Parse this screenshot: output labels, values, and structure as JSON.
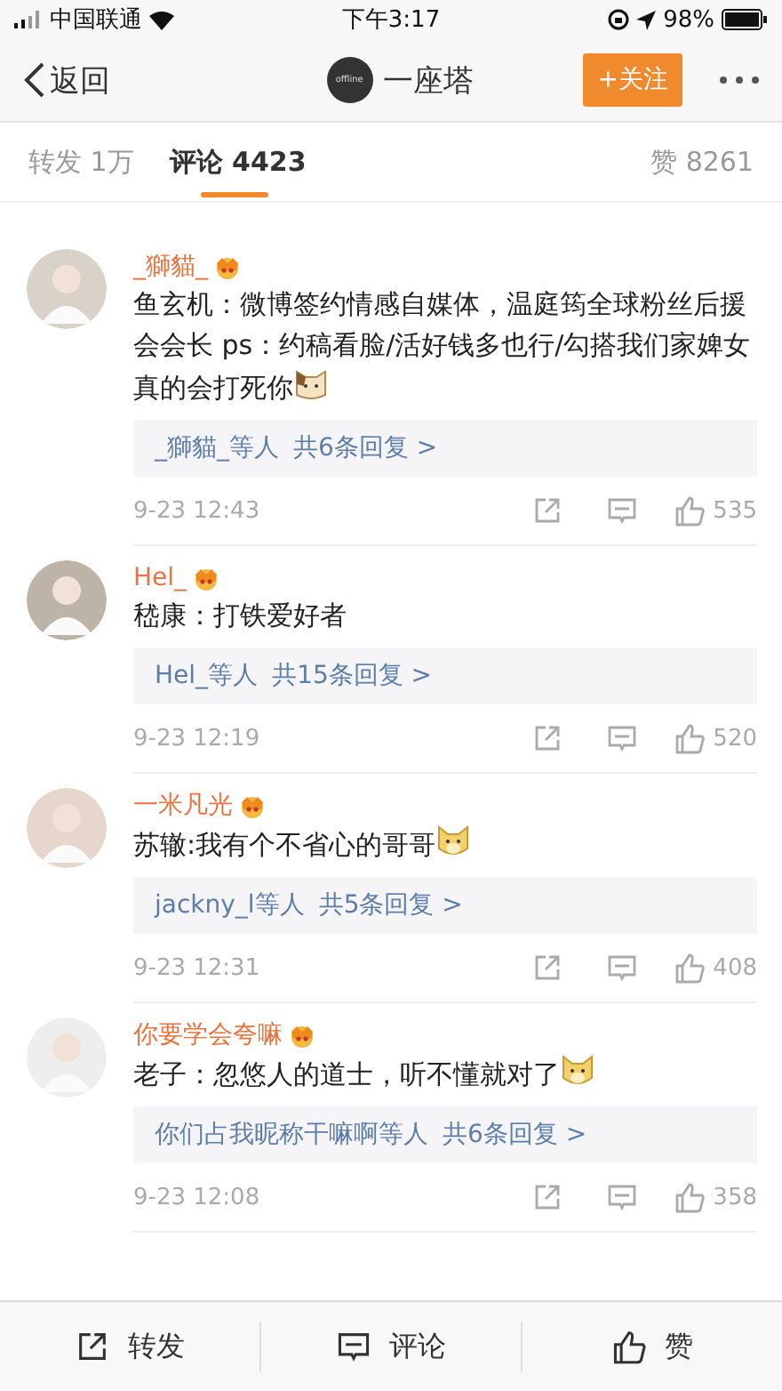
{
  "status_bar": {
    "carrier": "中国联通",
    "time": "下午3:17",
    "battery": "98%"
  },
  "nav": {
    "back": "返回",
    "avatar_text": "offline",
    "title": "一座塔",
    "follow": "+关注"
  },
  "tabs": [
    {
      "label": "转发 1万",
      "selected": false
    },
    {
      "label": "评论 4423",
      "selected": true
    }
  ],
  "likes_tab": "赞 8261",
  "comments": [
    {
      "name": "_獅貓_",
      "text": "鱼玄机：微博签约情感自媒体，温庭筠全球粉丝后援会会长 ps：约稿看脸/活好钱多也行/勾搭我们家婢女真的会打死你",
      "emoji": {
        "kind": "cat"
      },
      "replies_by": "_獅貓_等人",
      "replies": "共6条回复 >",
      "time": "9-23 12:43",
      "likes": "535"
    },
    {
      "name": "Hel_",
      "text": "嵇康：打铁爱好者",
      "replies_by": "Hel_等人",
      "replies": "共15条回复 >",
      "time": "9-23 12:19",
      "likes": "520"
    },
    {
      "name": "一米凡光",
      "text": "苏辙:我有个不省心的哥哥",
      "emoji": {
        "kind": "dog"
      },
      "replies_by": "jackny_l等人",
      "replies": "共5条回复 >",
      "time": "9-23 12:31",
      "likes": "408"
    },
    {
      "name": "你要学会夸嘛",
      "text": "老子：忽悠人的道士，听不懂就对了",
      "emoji": {
        "kind": "dog"
      },
      "replies_by": "你们占我昵称干嘛啊等人",
      "replies": "共6条回复 >",
      "time": "9-23 12:08",
      "likes": "358"
    }
  ],
  "bottom_bar": [
    "转发",
    "评论",
    "赞"
  ]
}
